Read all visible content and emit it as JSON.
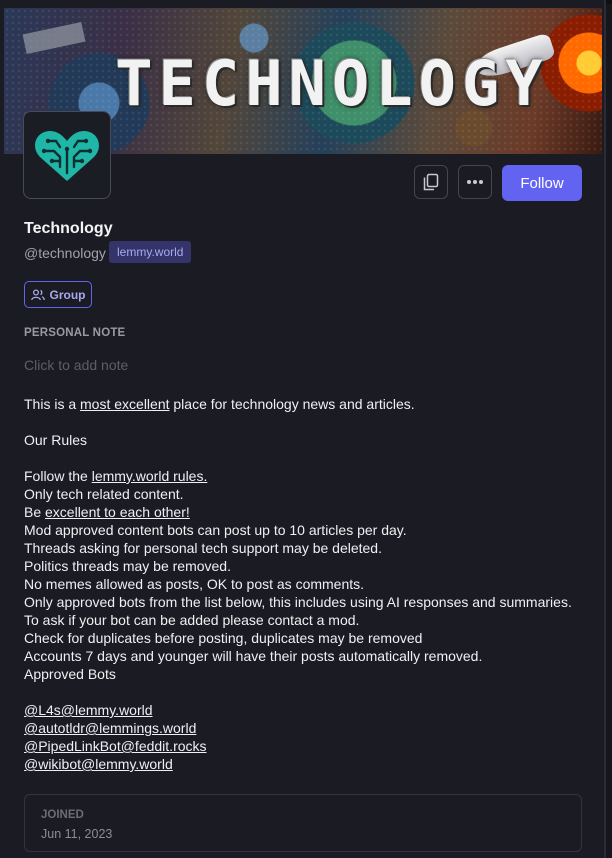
{
  "community": {
    "banner_text": "TECHNOLOGY",
    "title": "Technology",
    "handle": "@technology",
    "instance": "lemmy.world",
    "type_badge": "Group",
    "follow_label": "Follow"
  },
  "icons": {
    "avatar": "circuit-heart-icon",
    "copy": "copy-icon",
    "more": "more-horizontal-icon",
    "group": "users-icon"
  },
  "note": {
    "label": "PERSONAL NOTE",
    "placeholder": "Click to add note"
  },
  "description": {
    "intro_pre": "This is a ",
    "intro_link": "most excellent",
    "intro_post": " place for technology news and articles.",
    "rules_heading": "Our Rules",
    "rule1_pre": "Follow the ",
    "rule1_link": "lemmy.world rules.",
    "rule2": "Only tech related content.",
    "rule3_pre": "Be ",
    "rule3_link": "excellent to each other!",
    "rule4": "Mod approved content bots can post up to 10 articles per day.",
    "rule5": "Threads asking for personal tech support may be deleted.",
    "rule6": "Politics threads may be removed.",
    "rule7": "No memes allowed as posts, OK to post as comments.",
    "rule8": "Only approved bots from the list below, this includes using AI responses and summaries.",
    "rule9": "To ask if your bot can be added please contact a mod.",
    "rule10": "Check for duplicates before posting, duplicates may be removed",
    "rule11": "Accounts 7 days and younger will have their posts automatically removed.",
    "bots_heading": "Approved Bots",
    "bots": [
      "@L4s@lemmy.world",
      "@autotldr@lemmings.world",
      "@PipedLinkBot@feddit.rocks",
      "@wikibot@lemmy.world"
    ]
  },
  "joined": {
    "label": "JOINED",
    "date": "Jun 11, 2023"
  },
  "colors": {
    "accent": "#6363f1",
    "background": "#1b1b23",
    "avatar_teal": "#1fb5a7"
  }
}
